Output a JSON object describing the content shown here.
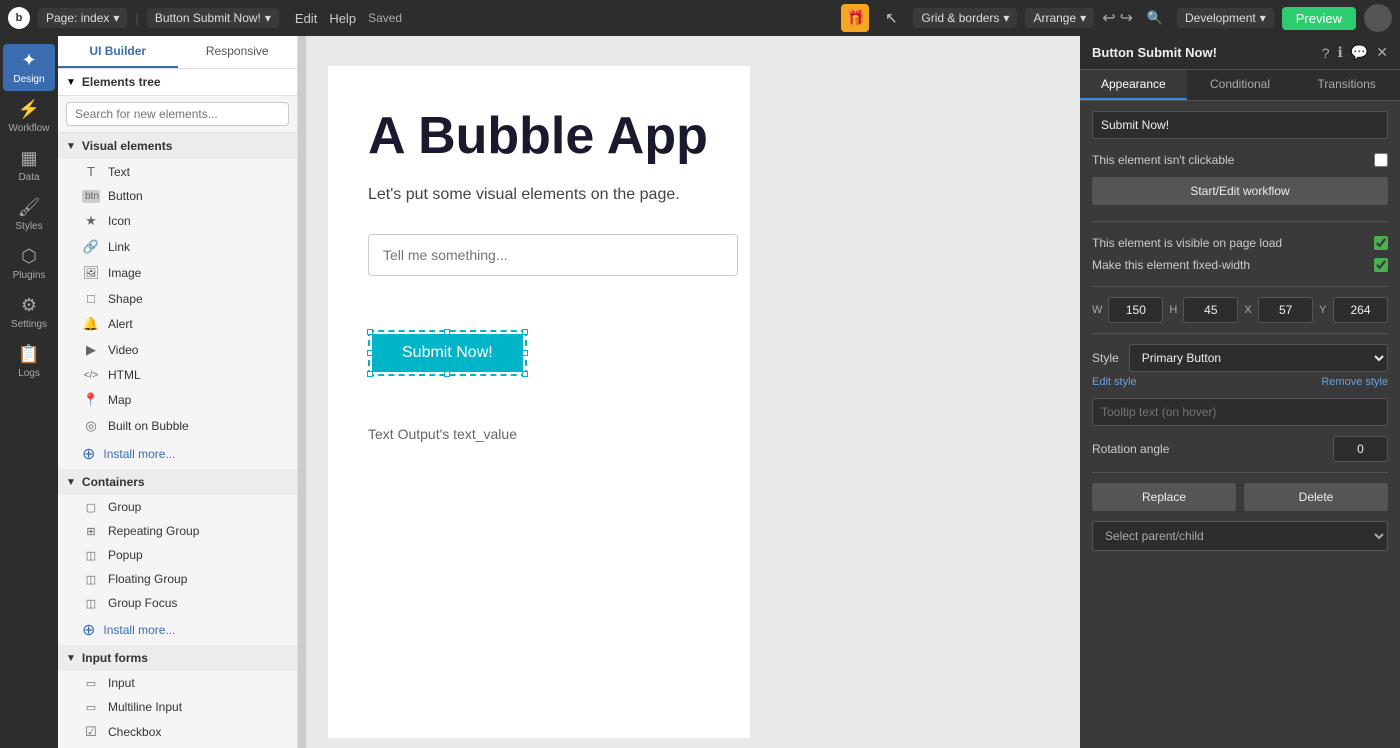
{
  "topbar": {
    "logo": "b",
    "page_label": "Page: index",
    "element_label": "Button Submit Now!",
    "edit_label": "Edit",
    "help_label": "Help",
    "saved_label": "Saved",
    "gift_icon": "🎁",
    "grid_label": "Grid & borders",
    "arrange_label": "Arrange",
    "dev_label": "Development",
    "preview_label": "Preview"
  },
  "left_icons": [
    {
      "id": "design",
      "label": "Design",
      "icon": "✦",
      "active": true
    },
    {
      "id": "workflow",
      "label": "Workflow",
      "icon": "⚡"
    },
    {
      "id": "data",
      "label": "Data",
      "icon": "🗄"
    },
    {
      "id": "styles",
      "label": "Styles",
      "icon": "🎨"
    },
    {
      "id": "plugins",
      "label": "Plugins",
      "icon": "🔌"
    },
    {
      "id": "settings",
      "label": "Settings",
      "icon": "⚙"
    },
    {
      "id": "logs",
      "label": "Logs",
      "icon": "📋"
    }
  ],
  "left_panel": {
    "tabs": [
      "UI Builder",
      "Responsive"
    ],
    "search_placeholder": "Search for new elements...",
    "elements_tree_label": "Elements tree",
    "visual_section": "Visual elements",
    "containers_section": "Containers",
    "input_forms_section": "Input forms",
    "visual_elements": [
      {
        "id": "text",
        "label": "Text",
        "icon": "T"
      },
      {
        "id": "button",
        "label": "Button",
        "icon": "▭"
      },
      {
        "id": "icon",
        "label": "Icon",
        "icon": "★"
      },
      {
        "id": "link",
        "label": "Link",
        "icon": "🔗"
      },
      {
        "id": "image",
        "label": "Image",
        "icon": "🖼"
      },
      {
        "id": "shape",
        "label": "Shape",
        "icon": "□"
      },
      {
        "id": "alert",
        "label": "Alert",
        "icon": "🔔"
      },
      {
        "id": "video",
        "label": "Video",
        "icon": "▶"
      },
      {
        "id": "html",
        "label": "HTML",
        "icon": "</>"
      },
      {
        "id": "map",
        "label": "Map",
        "icon": "📍"
      },
      {
        "id": "builtonbubble",
        "label": "Built on Bubble",
        "icon": "◎"
      }
    ],
    "install_more_1": "Install more...",
    "container_elements": [
      {
        "id": "group",
        "label": "Group",
        "icon": "▢"
      },
      {
        "id": "repeatinggroup",
        "label": "Repeating Group",
        "icon": "⊞"
      },
      {
        "id": "popup",
        "label": "Popup",
        "icon": "◫"
      },
      {
        "id": "floatinggroup",
        "label": "Floating Group",
        "icon": "◫"
      },
      {
        "id": "groupfocus",
        "label": "Group Focus",
        "icon": "◫"
      }
    ],
    "install_more_2": "Install more...",
    "input_elements": [
      {
        "id": "input",
        "label": "Input",
        "icon": "▭"
      },
      {
        "id": "multilineinput",
        "label": "Multiline Input",
        "icon": "▭"
      },
      {
        "id": "checkbox",
        "label": "Checkbox",
        "icon": "☑"
      }
    ]
  },
  "canvas": {
    "title": "A Bubble App",
    "subtitle": "Let's put some visual elements on the page.",
    "input_placeholder": "Tell me something...",
    "button_label": "Submit Now!",
    "text_output": "Text Output's text_value"
  },
  "right_panel": {
    "title": "Button Submit Now!",
    "tabs": [
      "Appearance",
      "Conditional",
      "Transitions"
    ],
    "button_name_value": "Submit Now!",
    "clickable_label": "This element isn't clickable",
    "workflow_btn": "Start/Edit workflow",
    "visible_label": "This element is visible on page load",
    "fixed_width_label": "Make this element fixed-width",
    "w_label": "W",
    "w_value": "150",
    "h_label": "H",
    "h_value": "45",
    "x_label": "X",
    "x_value": "57",
    "y_label": "Y",
    "y_value": "264",
    "style_label": "Style",
    "style_value": "Primary Button",
    "edit_style_label": "Edit style",
    "remove_style_label": "Remove style",
    "tooltip_placeholder": "Tooltip text (on hover)",
    "rotation_label": "Rotation angle",
    "rotation_value": "0",
    "replace_btn": "Replace",
    "delete_btn": "Delete",
    "select_parent_placeholder": "Select parent/child"
  }
}
